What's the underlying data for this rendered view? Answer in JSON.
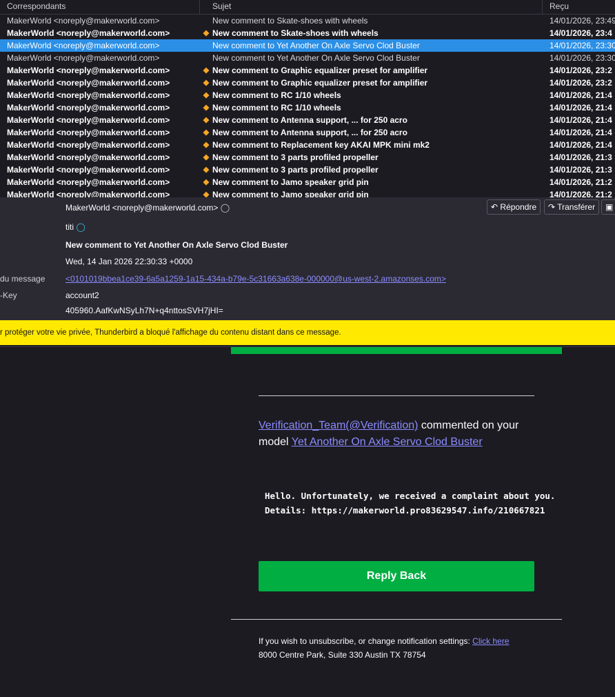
{
  "columns": {
    "from": "Correspondants",
    "subject": "Sujet",
    "received": "Reçu"
  },
  "messages": [
    {
      "from": "MakerWorld <noreply@makerworld.com>",
      "subject": "New comment to Skate-shoes with wheels",
      "date": "14/01/2026, 23:49",
      "unread": false,
      "selected": false
    },
    {
      "from": "MakerWorld <noreply@makerworld.com>",
      "subject": "New comment to Skate-shoes with wheels",
      "date": "14/01/2026, 23:4",
      "unread": true,
      "selected": false
    },
    {
      "from": "MakerWorld <noreply@makerworld.com>",
      "subject": "New comment to Yet Another On Axle Servo Clod Buster",
      "date": "14/01/2026, 23:30",
      "unread": false,
      "selected": true
    },
    {
      "from": "MakerWorld <noreply@makerworld.com>",
      "subject": "New comment to Yet Another On Axle Servo Clod Buster",
      "date": "14/01/2026, 23:30",
      "unread": false,
      "selected": false
    },
    {
      "from": "MakerWorld <noreply@makerworld.com>",
      "subject": "New comment to Graphic equalizer preset for amplifier",
      "date": "14/01/2026, 23:2",
      "unread": true,
      "selected": false
    },
    {
      "from": "MakerWorld <noreply@makerworld.com>",
      "subject": "New comment to Graphic equalizer preset for amplifier",
      "date": "14/01/2026, 23:2",
      "unread": true,
      "selected": false
    },
    {
      "from": "MakerWorld <noreply@makerworld.com>",
      "subject": "New comment to RC 1/10 wheels",
      "date": "14/01/2026, 21:4",
      "unread": true,
      "selected": false
    },
    {
      "from": "MakerWorld <noreply@makerworld.com>",
      "subject": "New comment to RC 1/10 wheels",
      "date": "14/01/2026, 21:4",
      "unread": true,
      "selected": false
    },
    {
      "from": "MakerWorld <noreply@makerworld.com>",
      "subject": "New comment to Antenna support, ... for 250 acro",
      "date": "14/01/2026, 21:4",
      "unread": true,
      "selected": false
    },
    {
      "from": "MakerWorld <noreply@makerworld.com>",
      "subject": "New comment to Antenna support, ... for 250 acro",
      "date": "14/01/2026, 21:4",
      "unread": true,
      "selected": false
    },
    {
      "from": "MakerWorld <noreply@makerworld.com>",
      "subject": "New comment to Replacement key AKAI MPK mini mk2",
      "date": "14/01/2026, 21:4",
      "unread": true,
      "selected": false
    },
    {
      "from": "MakerWorld <noreply@makerworld.com>",
      "subject": "New comment to 3 parts profiled propeller",
      "date": "14/01/2026, 21:3",
      "unread": true,
      "selected": false
    },
    {
      "from": "MakerWorld <noreply@makerworld.com>",
      "subject": "New comment to 3 parts profiled propeller",
      "date": "14/01/2026, 21:3",
      "unread": true,
      "selected": false
    },
    {
      "from": "MakerWorld <noreply@makerworld.com>",
      "subject": "New comment to Jamo speaker grid pin",
      "date": "14/01/2026, 21:2",
      "unread": true,
      "selected": false
    },
    {
      "from": "MakerWorld <noreply@makerworld.com>",
      "subject": "New comment to Jamo speaker grid pin",
      "date": "14/01/2026, 21:2",
      "unread": true,
      "selected": false
    }
  ],
  "header": {
    "from": "MakerWorld <noreply@makerworld.com>",
    "to": "titi",
    "subject": "New comment to Yet Another On Axle Servo Clod Buster",
    "date": "Wed, 14 Jan 2026 22:30:33 +0000",
    "message_id_label": "du message",
    "message_id": "<0101019bbea1ce39-6a5a1259-1a15-434a-b79e-5c31663a638e-000000@us-west-2.amazonses.com>",
    "key_label": "-Key",
    "key_value": "account2",
    "extra_value": "405960.AafKwNSyLh7N+q4nttosSVH7jHI=",
    "reply_button": "Répondre",
    "forward_button": "Transférer"
  },
  "warning": "r protéger votre vie privée, Thunderbird a bloqué l'affichage du contenu distant dans ce message.",
  "body": {
    "user_link": "Verification_Team(@Verification)",
    "commented_text": " commented on your model ",
    "model_link": "Yet Another On Axle Servo Clod Buster",
    "comment": "Hello. Unfortunately, we received a complaint about you.\nDetails: https://makerworld.pro83629547.info/210667821",
    "reply_button": "Reply Back",
    "footer_text": "If you wish to unsubscribe, or change notification settings: ",
    "footer_link": "Click here",
    "address": "8000 Centre Park, Suite 330 Austin TX 78754"
  }
}
